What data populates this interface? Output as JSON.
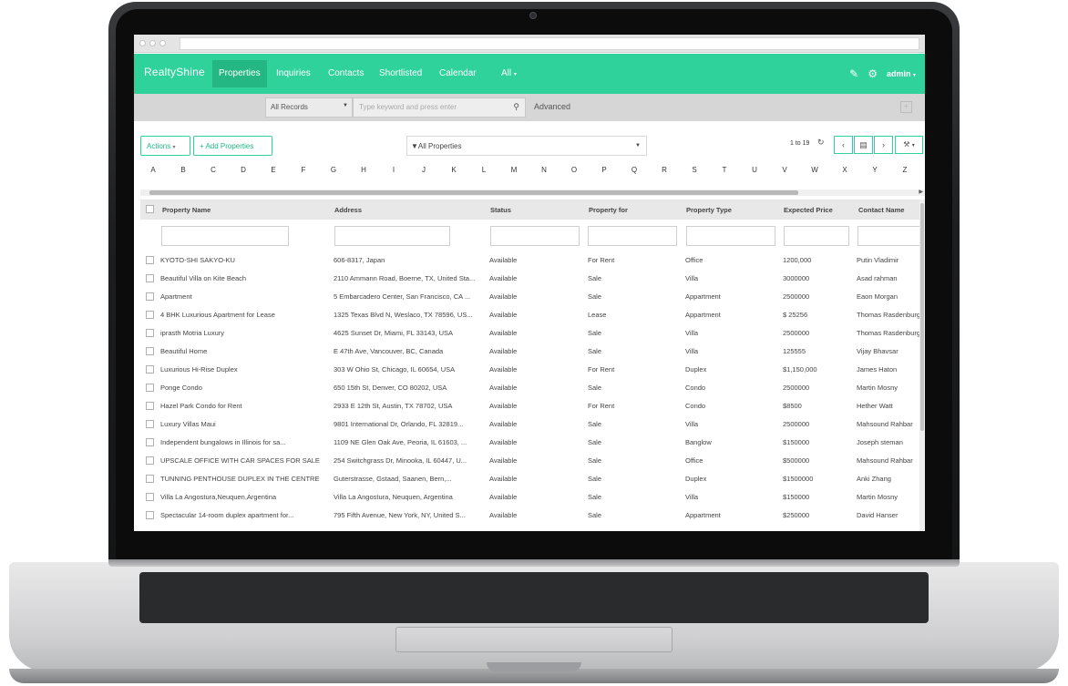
{
  "app": {
    "logo": "RealtyShine",
    "nav": [
      "Properties",
      "Inquiries",
      "Contacts",
      "Shortlisted",
      "Calendar",
      "All"
    ],
    "active_nav": "Properties",
    "user": "admin",
    "colors": {
      "brand": "#2fd29a",
      "brand_dark": "#24b784"
    }
  },
  "search": {
    "record_filter": "All Records",
    "placeholder": "Type keyword and press enter",
    "advanced_label": "Advanced"
  },
  "toolbar": {
    "actions_label": "Actions",
    "add_label": "Add Properties",
    "view_filter": "All Properties",
    "pager": "1 to 19"
  },
  "alphabet": [
    "A",
    "B",
    "C",
    "D",
    "E",
    "F",
    "G",
    "H",
    "I",
    "J",
    "K",
    "L",
    "M",
    "N",
    "O",
    "P",
    "Q",
    "R",
    "S",
    "T",
    "U",
    "V",
    "W",
    "X",
    "Y",
    "Z"
  ],
  "table": {
    "columns": [
      "Property Name",
      "Address",
      "Status",
      "Property for",
      "Property Type",
      "Expected Price",
      "Contact Name"
    ],
    "rows": [
      [
        "KYOTO-SHI SAKYO-KU",
        "606-8317, Japan",
        "Available",
        "For Rent",
        "Office",
        "1200,000",
        "Putin Vladimir"
      ],
      [
        "Beautiful Villa on Kite Beach",
        "2110 Ammann Road, Boerne, TX, United Sta...",
        "Available",
        "Sale",
        "Villa",
        "3000000",
        "Asad rahman"
      ],
      [
        "Apartment",
        "5 Embarcadero Center, San Francisco, CA ...",
        "Available",
        "Sale",
        "Appartment",
        "2500000",
        "Eaon Morgan"
      ],
      [
        "4 BHK Luxurious Apartment for Lease",
        "1325 Texas Blvd N, Weslaco, TX 78596, US...",
        "Available",
        "Lease",
        "Appartment",
        "$ 25256",
        "Thomas Rasdenburg"
      ],
      [
        "iprasth Motria Luxury",
        "4625 Sunset Dr, Miami, FL 33143, USA",
        "Available",
        "Sale",
        "Villa",
        "2500000",
        "Thomas Rasdenburg"
      ],
      [
        "Beautiful Home",
        "E 47th Ave, Vancouver, BC, Canada",
        "Available",
        "Sale",
        "Villa",
        "125555",
        "Vijay Bhavsar"
      ],
      [
        "Luxurious Hi-Rise Duplex",
        "303 W Ohio St, Chicago, IL 60654, USA",
        "Available",
        "For Rent",
        "Duplex",
        "$1,150,000",
        "James Haton"
      ],
      [
        "Ponge Condo",
        "650 15th St, Denver, CO 80202, USA",
        "Available",
        "Sale",
        "Condo",
        "2500000",
        "Martin Mosny"
      ],
      [
        "Hazel Park Condo for Rent",
        "2933 E 12th St, Austin, TX 78702, USA",
        "Available",
        "For Rent",
        "Condo",
        "$8500",
        "Hether Watt"
      ],
      [
        "Luxury Villas Maui",
        "9801 International Dr, Orlando, FL 32819...",
        "Available",
        "Sale",
        "Villa",
        "2500000",
        "Mahsound Rahbar"
      ],
      [
        "Independent bungalows in Illinois for sa...",
        "1109 NE Glen Oak Ave, Peoria, IL 61603, ...",
        "Available",
        "Sale",
        "Banglow",
        "$150000",
        "Joseph steman"
      ],
      [
        "UPSCALE OFFICE WITH CAR SPACES FOR SALE",
        "254 Switchgrass Dr, Minooka, IL 60447, U...",
        "Available",
        "Sale",
        "Office",
        "$500000",
        "Mahsound Rahbar"
      ],
      [
        "TUNNING PENTHOUSE DUPLEX IN THE CENTRE",
        "Guterstrasse, Gstaad, Saanen, Bern,...",
        "Available",
        "Sale",
        "Duplex",
        "$1500000",
        "Anki Zhang"
      ],
      [
        "Villa La Angostura,Neuquen,Argentina",
        "Villa La Angostura, Neuquen, Argentina",
        "Available",
        "Sale",
        "Villa",
        "$150000",
        "Martin Mosny"
      ],
      [
        "Spectacular 14-room duplex apartment for...",
        "795 Fifth Avenue, New York, NY, United S...",
        "Available",
        "Sale",
        "Appartment",
        "$250000",
        "David Hanser"
      ]
    ]
  }
}
